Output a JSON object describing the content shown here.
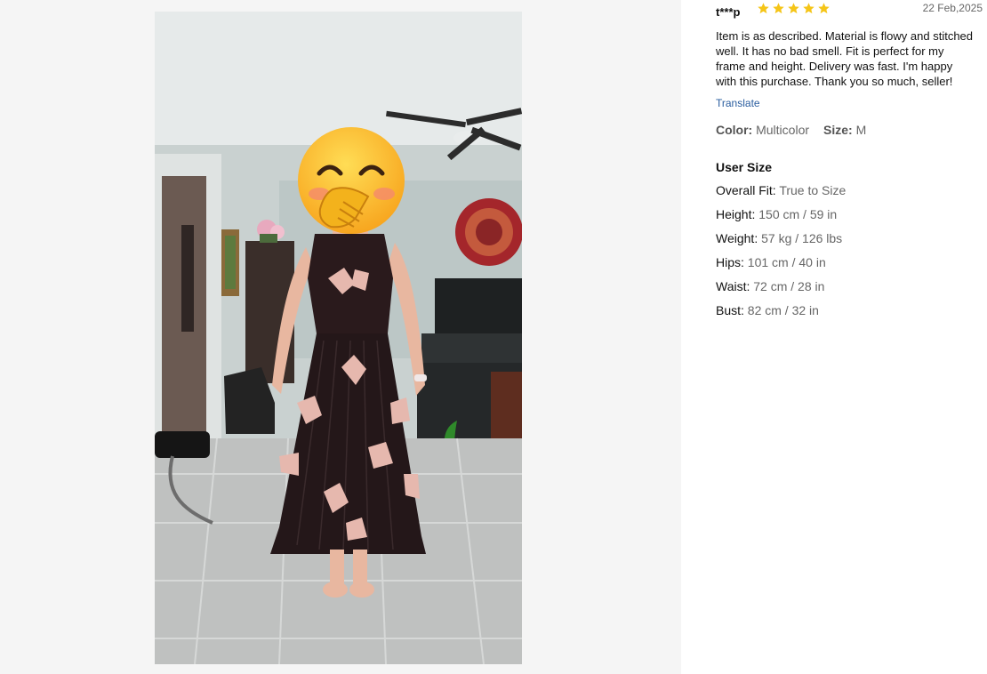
{
  "review": {
    "username": "t***p",
    "rating": 5,
    "date": "22 Feb,2025",
    "text": "Item is as described. Material is flowy and stitched well. It has no bad smell. Fit is perfect for my frame and height. Delivery was fast. I'm happy with this purchase. Thank you so much, seller!",
    "translate_label": "Translate",
    "color_label": "Color:",
    "color_value": "Multicolor",
    "size_label": "Size:",
    "size_value": "M"
  },
  "user_size": {
    "title": "User Size",
    "rows": [
      {
        "label": "Overall Fit:",
        "value": "True to Size"
      },
      {
        "label": "Height:",
        "value": "150 cm / 59 in"
      },
      {
        "label": "Weight:",
        "value": "57 kg / 126 lbs"
      },
      {
        "label": "Hips:",
        "value": "101 cm / 40 in"
      },
      {
        "label": "Waist:",
        "value": "72 cm / 28 in"
      },
      {
        "label": "Bust:",
        "value": "82 cm / 32 in"
      }
    ]
  },
  "colors": {
    "star": "#f5c518",
    "link": "#2a5d9f",
    "panel_bg": "#f5f5f5"
  },
  "photo": {
    "icons": [
      "face-covering-emoji"
    ]
  }
}
